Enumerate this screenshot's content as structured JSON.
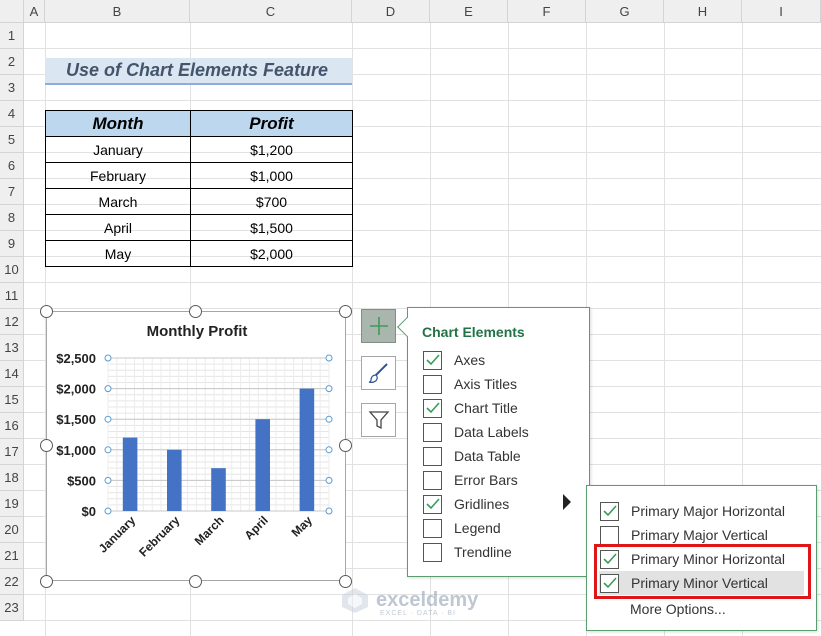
{
  "sheet": {
    "columns": [
      "A",
      "B",
      "C",
      "D",
      "E",
      "F",
      "G",
      "H",
      "I"
    ],
    "rows": [
      "1",
      "2",
      "3",
      "4",
      "5",
      "6",
      "7",
      "8",
      "9",
      "10",
      "11",
      "12",
      "13",
      "14",
      "15",
      "16",
      "17",
      "18",
      "19",
      "20",
      "21",
      "22",
      "23"
    ]
  },
  "title_cell": "Use of Chart Elements Feature",
  "table": {
    "headers": [
      "Month",
      "Profit"
    ],
    "rows": [
      [
        "January",
        "$1,200"
      ],
      [
        "February",
        "$1,000"
      ],
      [
        "March",
        "$700"
      ],
      [
        "April",
        "$1,500"
      ],
      [
        "May",
        "$2,000"
      ]
    ]
  },
  "chart_data": {
    "type": "bar",
    "title": "Monthly Profit",
    "categories": [
      "January",
      "February",
      "March",
      "April",
      "May"
    ],
    "values": [
      1200,
      1000,
      700,
      1500,
      2000
    ],
    "y_ticks": [
      "$0",
      "$500",
      "$1,000",
      "$1,500",
      "$2,000",
      "$2,500"
    ],
    "ylim": [
      0,
      2500
    ],
    "minor_step": 100,
    "grid": true,
    "bar_color": "#4472c4"
  },
  "chart_elements_panel": {
    "title": "Chart Elements",
    "items": [
      {
        "label": "Axes",
        "checked": true
      },
      {
        "label": "Axis Titles",
        "checked": false
      },
      {
        "label": "Chart Title",
        "checked": true
      },
      {
        "label": "Data Labels",
        "checked": false
      },
      {
        "label": "Data Table",
        "checked": false
      },
      {
        "label": "Error Bars",
        "checked": false
      },
      {
        "label": "Gridlines",
        "checked": true
      },
      {
        "label": "Legend",
        "checked": false
      },
      {
        "label": "Trendline",
        "checked": false
      }
    ]
  },
  "gridlines_submenu": {
    "items": [
      {
        "label": "Primary Major Horizontal",
        "checked": true
      },
      {
        "label": "Primary Major Vertical",
        "checked": false
      },
      {
        "label": "Primary Minor Horizontal",
        "checked": true
      },
      {
        "label": "Primary Minor Vertical",
        "checked": true
      }
    ],
    "more_options": "More Options..."
  },
  "watermark": {
    "name": "exceldemy",
    "tagline": "EXCEL · DATA · BI"
  },
  "colors": {
    "accent_green": "#217346",
    "check_green": "#3c9b5a",
    "highlight_red": "#e01515",
    "header_fill": "#bdd7ee",
    "title_fill": "#dbe6f3"
  }
}
